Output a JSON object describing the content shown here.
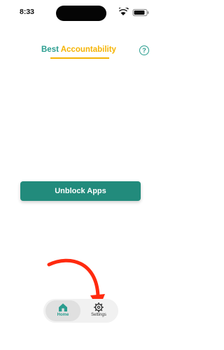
{
  "status_bar": {
    "time": "8:33"
  },
  "header": {
    "title_part1": "Best",
    "title_part2": "Accountability",
    "help_symbol": "?"
  },
  "main": {
    "unblock_button_label": "Unblock Apps"
  },
  "tabbar": {
    "tabs": [
      {
        "label": "Home",
        "icon": "home-icon",
        "active": true
      },
      {
        "label": "Settings",
        "icon": "gear-icon",
        "active": false
      }
    ]
  },
  "colors": {
    "teal": "#2a9d8f",
    "button": "#228b7c",
    "yellow": "#f5b301",
    "arrow": "#ff2a0f"
  }
}
